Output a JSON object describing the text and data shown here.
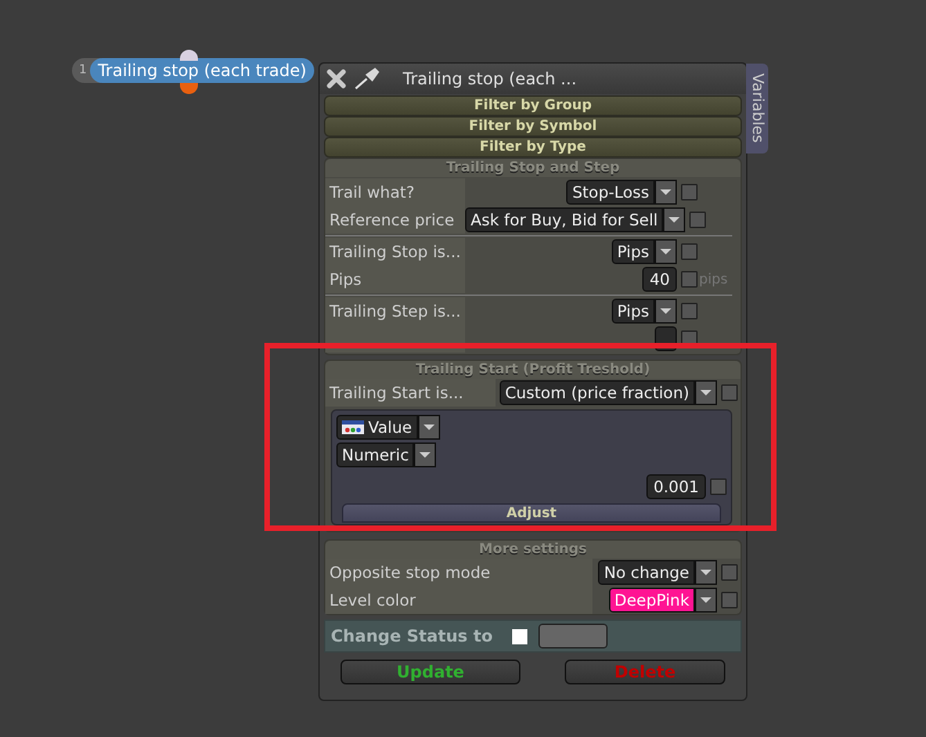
{
  "node": {
    "index": "1",
    "title": "Trailing stop (each trade)"
  },
  "panel": {
    "title": "Trailing stop (each ...",
    "side_tab": "Variables"
  },
  "filters": [
    "Filter by Group",
    "Filter by Symbol",
    "Filter by Type"
  ],
  "trailing_stop_and_step": {
    "title": "Trailing Stop and Step",
    "groups": [
      [
        {
          "label": "Trail what?",
          "kind": "dropdown",
          "value": "Stop-Loss",
          "checked": false
        },
        {
          "label": "Reference price",
          "kind": "dropdown",
          "value": "Ask for Buy, Bid for Sell",
          "checked": false
        }
      ],
      [
        {
          "label": "Trailing Stop is...",
          "kind": "dropdown",
          "value": "Pips",
          "checked": false
        },
        {
          "label": "Pips",
          "kind": "number",
          "value": "40",
          "unit": "pips",
          "checked": false
        }
      ],
      [
        {
          "label": "Trailing Step is...",
          "kind": "dropdown",
          "value": "Pips",
          "checked": false
        },
        {
          "kind": "number",
          "checked": false
        }
      ]
    ]
  },
  "trailing_start": {
    "title": "Trailing Start (Profit Treshold)",
    "label": "Trailing Start is...",
    "value": "Custom (price fraction)",
    "checked": false,
    "expression": {
      "source": "Value",
      "type": "Numeric",
      "value": "0.001",
      "checked": false
    },
    "adjust": "Adjust"
  },
  "more_settings": {
    "title": "More settings",
    "rows": [
      {
        "label": "Opposite stop mode",
        "kind": "dropdown",
        "value": "No change",
        "checked": false
      },
      {
        "label": "Level color",
        "kind": "color",
        "value": "DeepPink",
        "color": "#ff1493",
        "checked": false
      }
    ]
  },
  "change_status": {
    "label": "Change Status to",
    "checked": false
  },
  "buttons": [
    {
      "label": "Update",
      "kind": "update"
    },
    {
      "label": "Delete",
      "kind": "delete"
    }
  ]
}
